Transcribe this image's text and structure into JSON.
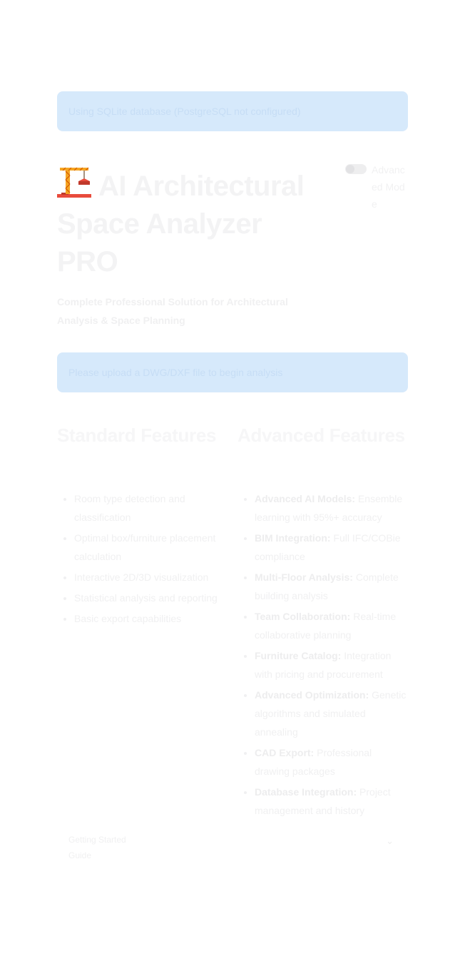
{
  "alerts": {
    "database": "Using SQLite database (PostgreSQL not configured)",
    "upload": "Please upload a DWG/DXF file to begin analysis"
  },
  "header": {
    "icon": "construction-crane-icon",
    "title": "AI Architectural Space Analyzer PRO",
    "subtitle": "Complete Professional Solution for Architectural Analysis & Space Planning"
  },
  "mode_toggle": {
    "label": "Advanced Mode",
    "enabled": false
  },
  "standard_features": {
    "heading": "Standard Features",
    "items": [
      "Room type detection and classification",
      "Optimal box/furniture placement calculation",
      "Interactive 2D/3D visualization",
      "Statistical analysis and reporting",
      "Basic export capabilities"
    ]
  },
  "advanced_features": {
    "heading": "Advanced Features",
    "items": [
      {
        "name": "Advanced AI Models:",
        "desc": " Ensemble learning with 95%+ accuracy"
      },
      {
        "name": "BIM Integration:",
        "desc": " Full IFC/COBie compliance"
      },
      {
        "name": "Multi-Floor Analysis:",
        "desc": " Complete building analysis"
      },
      {
        "name": "Team Collaboration:",
        "desc": " Real-time collaborative planning"
      },
      {
        "name": "Furniture Catalog:",
        "desc": " Integration with pricing and procurement"
      },
      {
        "name": "Advanced Optimization:",
        "desc": " Genetic algorithms and simulated annealing"
      },
      {
        "name": "CAD Export:",
        "desc": " Professional drawing packages"
      },
      {
        "name": "Database Integration:",
        "desc": " Project management and history"
      }
    ]
  },
  "footer_select": {
    "value": "Getting Started Guide",
    "icon": "chevron-down-icon"
  },
  "colors": {
    "alert_bg": "#d6e9fb",
    "alert_text": "#c6ddf5",
    "crane_red": "#e84b3c",
    "crane_gold": "#f5a623"
  }
}
